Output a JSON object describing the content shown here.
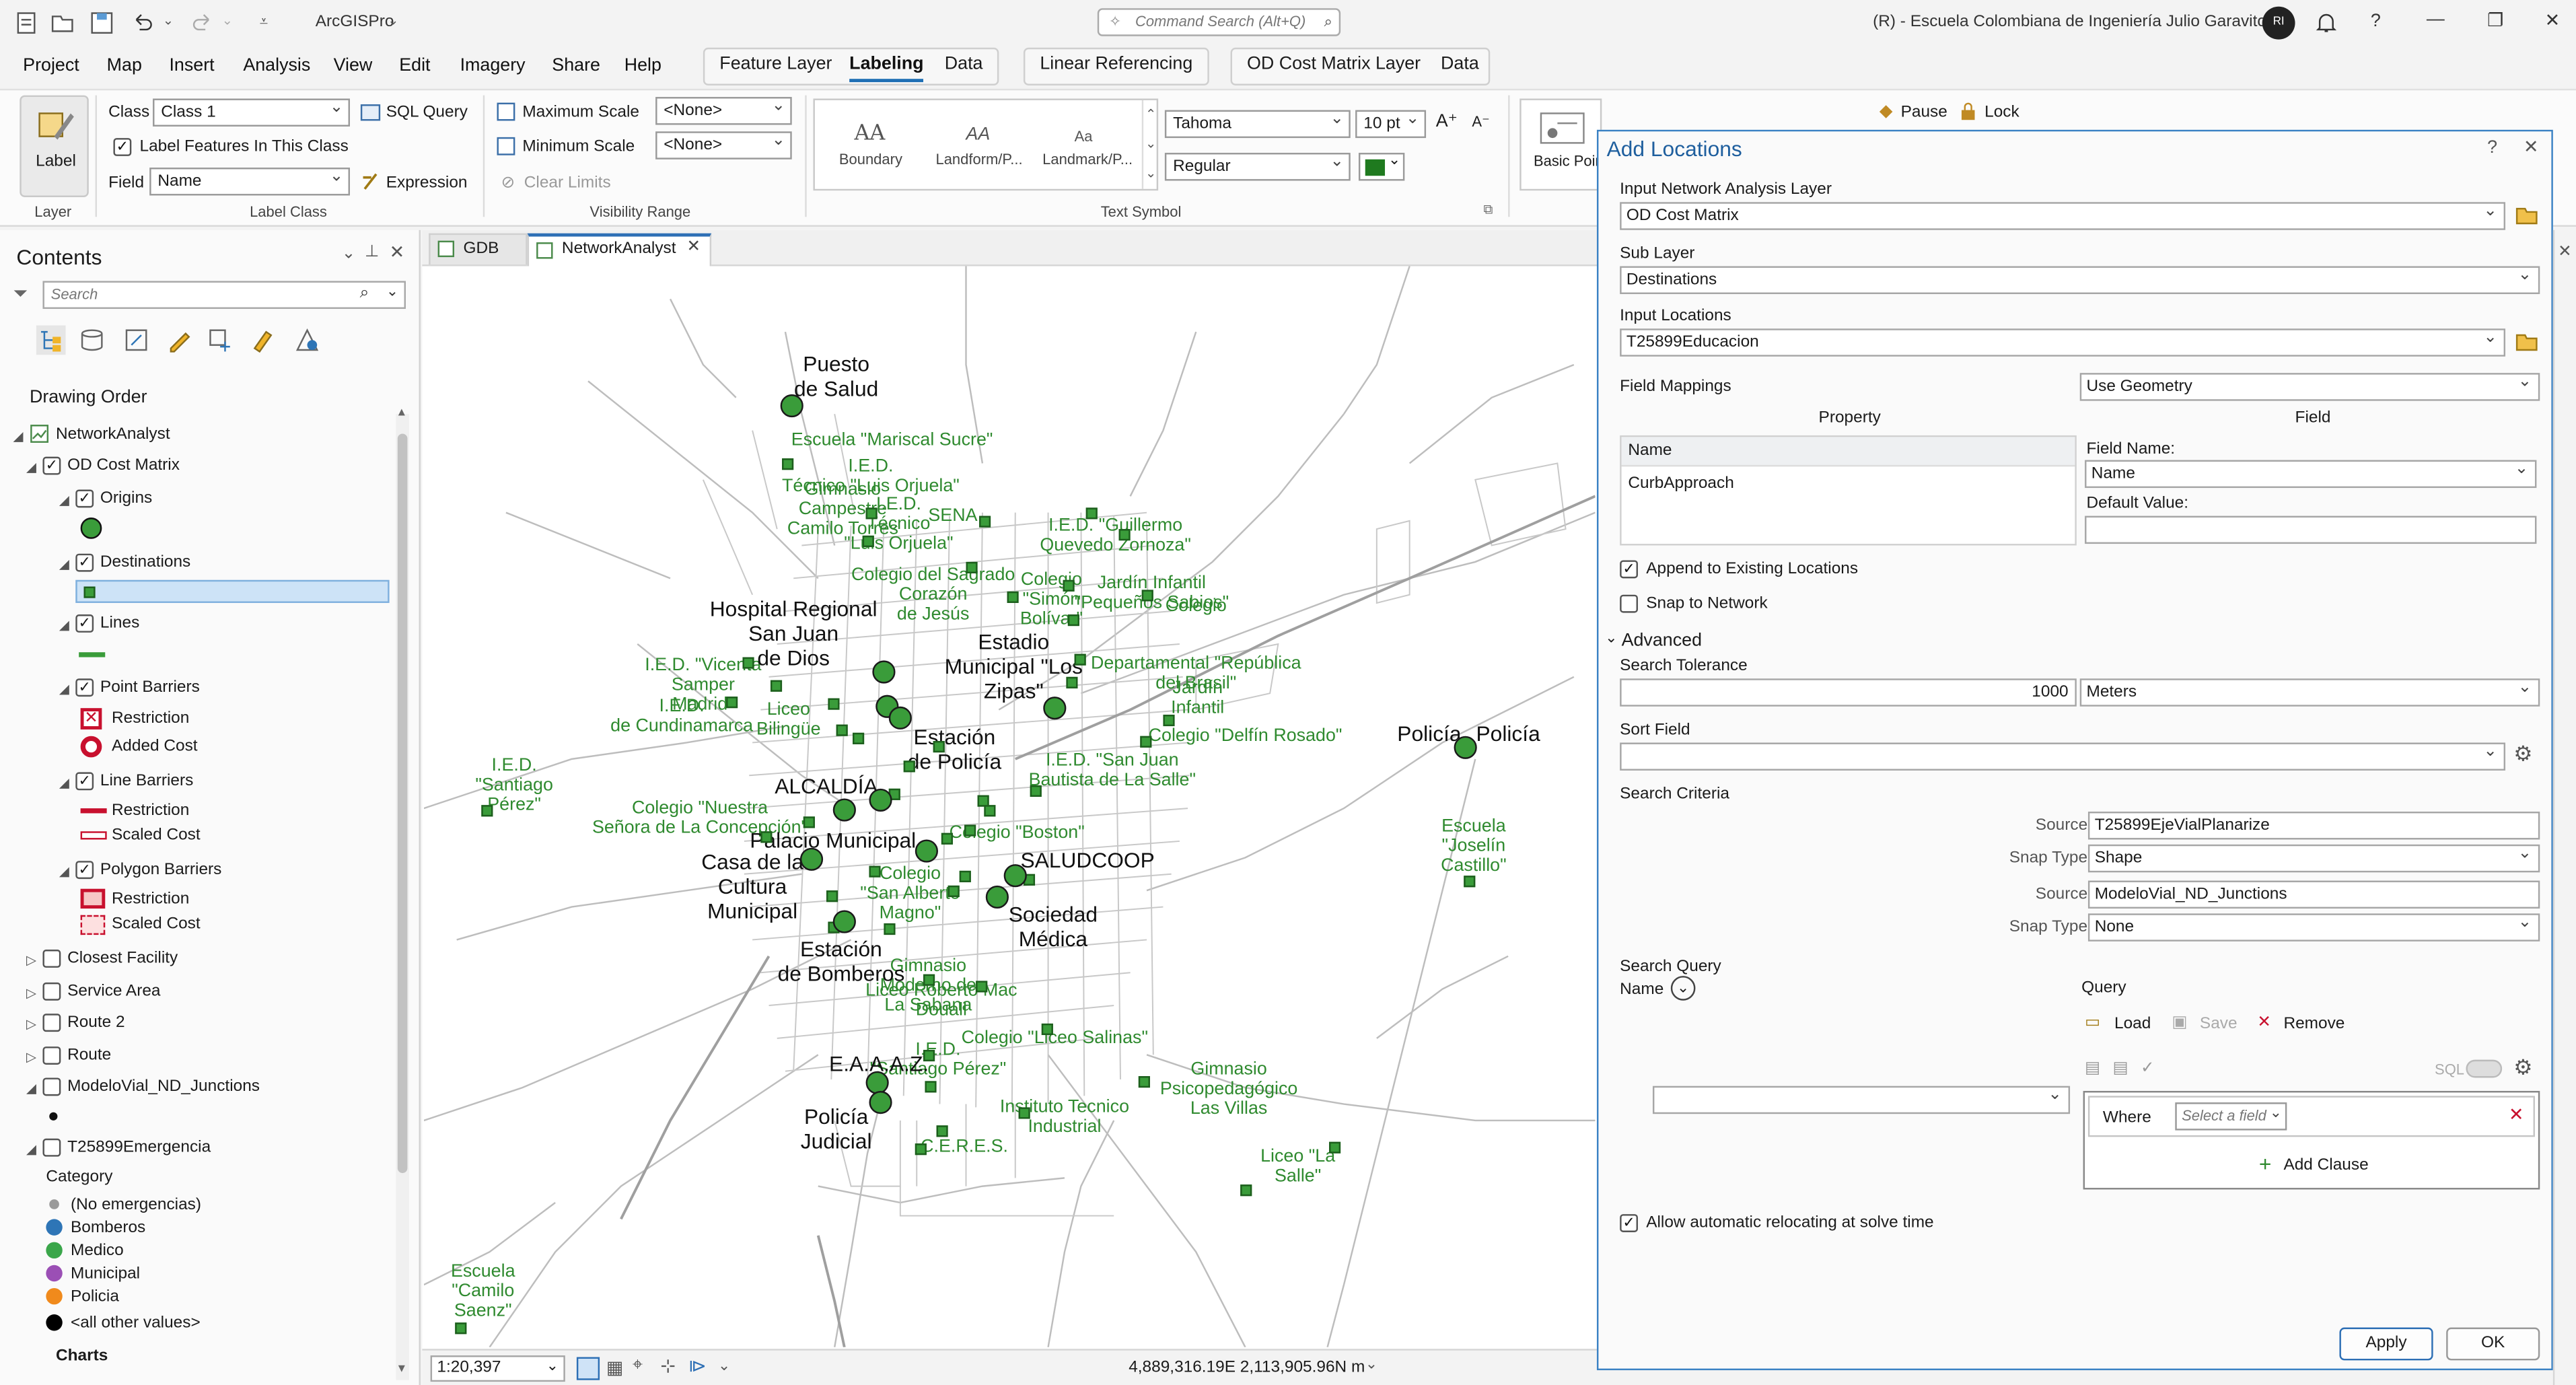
{
  "app": {
    "name": "ArcGISPro",
    "command_search_placeholder": "Command Search (Alt+Q)",
    "account": "(R) - Escuela Colombiana de Ingeniería Julio Garavito",
    "avatar_initials": "RI",
    "window_controls": {
      "help": "?",
      "minimize": "—",
      "restore": "❐",
      "close": "✕"
    }
  },
  "menu": {
    "items": [
      "Project",
      "Map",
      "Insert",
      "Analysis",
      "View",
      "Edit",
      "Imagery",
      "Share",
      "Help"
    ],
    "feature_layer_tabs": [
      "Feature Layer",
      "Labeling",
      "Data"
    ],
    "linear_referencing": "Linear Referencing",
    "od_tabs": [
      "OD Cost Matrix Layer",
      "Data"
    ]
  },
  "ribbon": {
    "layer_group": {
      "button": "Label",
      "caption": "Layer"
    },
    "label_class": {
      "class_label": "Class",
      "class_value": "Class 1",
      "sql_query": "SQL Query",
      "label_features": "Label Features In This Class",
      "field_label": "Field",
      "field_value": "Name",
      "expression": "Expression",
      "caption": "Label Class"
    },
    "visibility": {
      "max_scale": "Maximum Scale",
      "max_value": "<None>",
      "min_scale": "Minimum Scale",
      "min_value": "<None>",
      "clear_limits": "Clear Limits",
      "caption": "Visibility Range"
    },
    "text_symbol": {
      "styles": [
        "Boundary",
        "Landform/P...",
        "Landmark/P..."
      ],
      "font": "Tahoma",
      "size": "10 pt",
      "style": "Regular",
      "caption": "Text Symbol"
    },
    "placement": {
      "basic_point": "Basic Point"
    },
    "misc": {
      "pause": "Pause",
      "lock": "Lock"
    },
    "color_swatch": "#1f7a1f"
  },
  "contents": {
    "title": "Contents",
    "search_placeholder": "Search",
    "drawing_order": "Drawing Order",
    "layers": {
      "network_analyst": "NetworkAnalyst",
      "od_cost_matrix": "OD Cost Matrix",
      "origins": "Origins",
      "destinations": "Destinations",
      "lines": "Lines",
      "point_barriers": "Point Barriers",
      "pb_restriction": "Restriction",
      "pb_added_cost": "Added Cost",
      "line_barriers": "Line Barriers",
      "lb_restriction": "Restriction",
      "lb_scaled_cost": "Scaled Cost",
      "polygon_barriers": "Polygon Barriers",
      "poly_restriction": "Restriction",
      "poly_scaled_cost": "Scaled Cost",
      "closest_facility": "Closest Facility",
      "service_area": "Service Area",
      "route2": "Route 2",
      "route": "Route",
      "modelovial": "ModeloVial_ND_Junctions",
      "emergencia": "T25899Emergencia",
      "category": "Category",
      "cat_none": "(No emergencias)",
      "cat_bomberos": "Bomberos",
      "cat_medico": "Medico",
      "cat_municipal": "Municipal",
      "cat_policia": "Policia",
      "cat_all": "<all other values>",
      "charts": "Charts"
    },
    "colors": {
      "bomberos": "#2e75b6",
      "medico": "#3aa64a",
      "municipal": "#9b4fb5",
      "policia": "#f08a1c",
      "none": "#9a9a9a",
      "all": "#000000"
    }
  },
  "map": {
    "tabs": [
      "GDB",
      "NetworkAnalyst"
    ],
    "scale": "1:20,397",
    "coordinates": "4,889,316.19E 2,113,905.96N m",
    "green_labels": [
      "Escuela \"Mariscal Sucre\"",
      "I.E.D.\nTécnico \"Luis Orjuela\"",
      "Gimnasio\nCampestre\nCamilo Torres",
      "I.E.D.\nTécnico\n\"Luis Orjuela\"",
      "SENA",
      "I.E.D. \"Guillermo\nQuevedo Zornoza\"",
      "Colegio del Sagrado\nCorazón\nde Jesús",
      "Colegio\n\"Simón\nBolívar\"",
      "Jardín Infantil\n\"Pequeños Sabios\"",
      "Colegio",
      "I.E.D. \"Vicenta\nSamper\nMadrid\"",
      "Departamental \"República\ndel Brasil\"",
      "I.E.D.\nde Cundinamarca",
      "Liceo\nBilingüe",
      "Jardín\nInfantil",
      "Colegio \"Delfín Rosado\"",
      "I.E.D.\n\"Santiago\nPérez\"",
      "I.E.D. \"San Juan\nBautista de La Salle\"",
      "Colegio \"Nuestra\nSeñora de La Concepción\"",
      "Colegio \"Boston\"",
      "Colegio\n\"San Alberto\nMagno\"",
      "Escuela\n\"Joselín\nCastillo\"",
      "Gimnasio\nModerno de\nLa Sabana",
      "Liceo Roberto Mac\nDouall",
      "Colegio \"Liceo Salinas\"",
      "I.E.D.\n\"Santiago Pérez\"",
      "Gimnasio\nPsicopedagógico\nLas Villas",
      "Instituto Tecnico\nIndustrial",
      "C.E.R.E.S.",
      "Liceo \"La\nSalle\"",
      "Escuela\n\"Camilo\nSaenz\""
    ],
    "black_labels": [
      "Puesto\nde Salud",
      "Hospital Regional\nSan Juan\nde Dios",
      "Estadio\nMunicipal \"Los\nZipas\"",
      "Estación\nde Policía",
      "ALCALDÍA",
      "Palacio Municipal",
      "Casa de la\nCultura\nMunicipal",
      "SALUDCOOP",
      "Sociedad\nMédica",
      "Estación\nde Bomberos",
      "E.A.A.A.Z.",
      "Policía\nJudicial",
      "Policía",
      "Policía"
    ]
  },
  "add_locations": {
    "title": "Add Locations",
    "input_layer_label": "Input Network Analysis Layer",
    "input_layer_value": "OD Cost Matrix",
    "sub_layer_label": "Sub Layer",
    "sub_layer_value": "Destinations",
    "input_locations_label": "Input Locations",
    "input_locations_value": "T25899Educacion",
    "field_mappings_label": "Field Mappings",
    "field_mappings_value": "Use Geometry",
    "property_header": "Property",
    "field_header": "Field",
    "properties": [
      "Name",
      "CurbApproach"
    ],
    "field_name_label": "Field Name:",
    "field_name_value": "Name",
    "default_value_label": "Default Value:",
    "append_label": "Append to Existing Locations",
    "snap_label": "Snap to Network",
    "advanced_label": "Advanced",
    "search_tolerance_label": "Search Tolerance",
    "search_tolerance_value": "1000",
    "search_tolerance_units": "Meters",
    "sort_field_label": "Sort Field",
    "search_criteria_label": "Search Criteria",
    "source_label": "Source",
    "snap_type_label": "Snap Type",
    "criteria": [
      {
        "source": "T25899EjeVialPlanarize",
        "snap_type": "Shape"
      },
      {
        "source": "ModeloVial_ND_Junctions",
        "snap_type": "None"
      }
    ],
    "search_query_label": "Search Query",
    "name_label": "Name",
    "query_label": "Query",
    "load": "Load",
    "save": "Save",
    "remove": "Remove",
    "sql": "SQL",
    "where": "Where",
    "select_field_placeholder": "Select a field",
    "add_clause": "Add Clause",
    "allow_relocate_label": "Allow automatic relocating at solve time",
    "apply": "Apply",
    "ok": "OK"
  }
}
